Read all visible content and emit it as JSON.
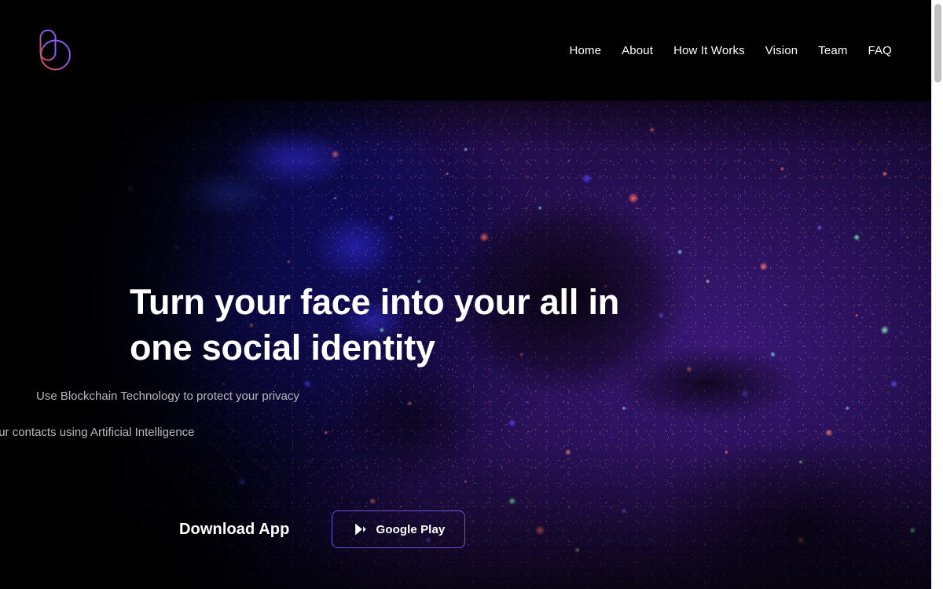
{
  "brand": {
    "logo_icon": "brand-b-logo-icon",
    "gradient_start": "#8b5cf6",
    "gradient_end": "#e0555a"
  },
  "nav": {
    "items": [
      {
        "label": "Home"
      },
      {
        "label": "About"
      },
      {
        "label": "How It Works"
      },
      {
        "label": "Vision"
      },
      {
        "label": "Team"
      },
      {
        "label": "FAQ"
      }
    ]
  },
  "hero": {
    "headline": "Turn your face into your all in one social identity",
    "sublines": [
      {
        "text": "Use Blockchain Technology to protect your privacy"
      },
      {
        "text": "Manage your contacts using Artificial Intelligence"
      }
    ],
    "download_label": "Download App",
    "store_button": {
      "label": "Google Play",
      "icon": "google-play-icon",
      "border_color": "#6f52d6"
    },
    "background_image": "neon-glitter-face-photo"
  },
  "scrollbar": {
    "track_color": "#fdfdfd",
    "thumb_color": "#c1c1c1"
  }
}
